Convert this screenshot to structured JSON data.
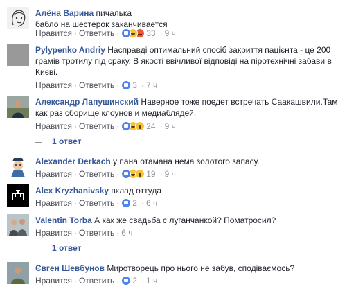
{
  "common": {
    "like_label": "Нравится",
    "reply_label": "Ответить",
    "separator": "·"
  },
  "colors": {
    "author": "#365899",
    "meta": "#90949c",
    "action": "#4b4f56",
    "like": "#4b83f5",
    "haha": "#f7c33a",
    "angry": "#e45a3a"
  },
  "comments": [
    {
      "author": "Алёна Варина",
      "text": "пичалька\nбабло на шестерок заканчивается",
      "reactions": [
        "like-icon",
        "haha-icon",
        "angry-icon"
      ],
      "reaction_count": "33",
      "time": "9 ч",
      "avatar": "vector-face-avatar"
    },
    {
      "author": "Pylypenko Andriy",
      "text": "Насправді оптимальний спосіб закриття пацієнта - це 200 грамів тротилу під сраку. В якості ввічливої відповіді на піротехнічні забави в Києві.",
      "reactions": [
        "like-icon"
      ],
      "reaction_count": "3",
      "time": "7 ч",
      "avatar": "gray-default-avatar"
    },
    {
      "author": "Александр Лапушинский",
      "text": "Наверное тоже поедет встречать Саакашвили.Там как раз сборище клоунов и медиаблядей.",
      "reactions": [
        "like-icon",
        "haha-icon",
        "wow-icon"
      ],
      "reaction_count": "24",
      "time": "9 ч",
      "avatar": "photo-man-avatar",
      "replies_label": "1 ответ"
    },
    {
      "author": "Alexander Derkach",
      "text": "у пана отамана нема золотого запасу.",
      "reactions": [
        "like-icon",
        "haha-icon",
        "wow-icon"
      ],
      "reaction_count": "19",
      "time": "9 ч",
      "avatar": "cartoon-avatar"
    },
    {
      "author": "Alex Kryzhanivsky",
      "text": "вклад оттуда",
      "reactions": [
        "like-icon"
      ],
      "reaction_count": "2",
      "time": "6 ч",
      "avatar": "tamga-emblem-avatar"
    },
    {
      "author": "Valentin Torba",
      "text": "А как же свадьба с луганчанкой? Поматросил?",
      "reactions": [],
      "reaction_count": "",
      "time": "6 ч",
      "avatar": "photo-group-avatar",
      "replies_label": "1 ответ"
    },
    {
      "author": "Євген Шевбунов",
      "text": "Миротворець про нього не забув, сподіваємось?",
      "reactions": [
        "like-icon"
      ],
      "reaction_count": "2",
      "time": "1 ч",
      "avatar": "photo-soldier-avatar"
    }
  ]
}
